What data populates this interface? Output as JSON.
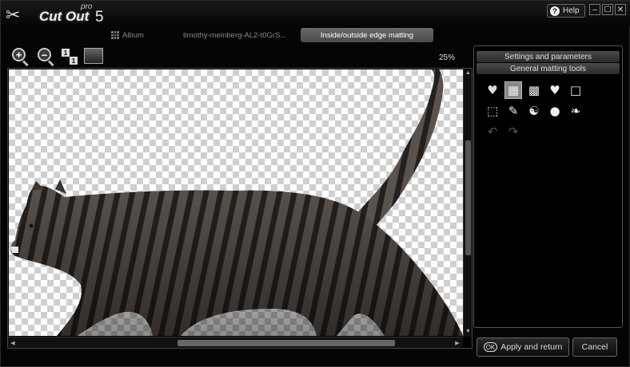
{
  "app": {
    "logo_text": "Cut Out",
    "logo_pro": "pro",
    "logo_version": "5"
  },
  "titlebar": {
    "help_label": "Help",
    "minimize": "–",
    "maximize": "☐",
    "close": "✕"
  },
  "tabs": {
    "album": "Album",
    "file": "timothy-meinberg-AL2-t0GrS...",
    "active": "Inside/outside edge matting"
  },
  "toolbar": {
    "zoom_in": "+",
    "zoom_out": "–",
    "actual_size_a": "1",
    "actual_size_b": "1",
    "zoom_level": "25%"
  },
  "panel": {
    "header_settings": "Settings and parameters",
    "header_tools": "General matting tools",
    "tools": [
      {
        "icon": "heart-fill-icon",
        "glyph": "♥"
      },
      {
        "icon": "checker-brush-icon",
        "glyph": "▦"
      },
      {
        "icon": "checker-icon",
        "glyph": "▩"
      },
      {
        "icon": "heart-icon",
        "glyph": "♥"
      },
      {
        "icon": "square-icon",
        "glyph": "□"
      },
      {
        "icon": "lasso-icon",
        "glyph": "⬚"
      },
      {
        "icon": "brush-icon",
        "glyph": "✎"
      },
      {
        "icon": "swirl-icon",
        "glyph": "☯"
      },
      {
        "icon": "sphere-icon",
        "glyph": "●"
      },
      {
        "icon": "feather-icon",
        "glyph": "❧"
      },
      {
        "icon": "undo-icon",
        "glyph": "↶"
      },
      {
        "icon": "redo-icon",
        "glyph": "↷"
      }
    ]
  },
  "buttons": {
    "ok_badge": "OK",
    "apply": "Apply and return",
    "cancel": "Cancel"
  }
}
